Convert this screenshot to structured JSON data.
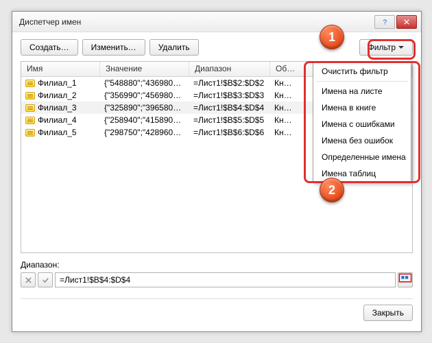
{
  "window": {
    "title": "Диспетчер имен"
  },
  "toolbar": {
    "create": "Создать…",
    "edit": "Изменить…",
    "delete": "Удалить",
    "filter": "Фильтр"
  },
  "columns": {
    "name": "Имя",
    "value": "Значение",
    "range": "Диапазон",
    "scope": "Об…"
  },
  "rows": [
    {
      "name": "Филиал_1",
      "value": "{\"548880\";\"436980…",
      "range": "=Лист1!$B$2:$D$2",
      "scope": "Кн…"
    },
    {
      "name": "Филиал_2",
      "value": "{\"356990\";\"456980…",
      "range": "=Лист1!$B$3:$D$3",
      "scope": "Кн…"
    },
    {
      "name": "Филиал_3",
      "value": "{\"325890\";\"396580…",
      "range": "=Лист1!$B$4:$D$4",
      "scope": "Кн…"
    },
    {
      "name": "Филиал_4",
      "value": "{\"258940\";\"415890…",
      "range": "=Лист1!$B$5:$D$5",
      "scope": "Кн…"
    },
    {
      "name": "Филиал_5",
      "value": "{\"298750\";\"428960…",
      "range": "=Лист1!$B$6:$D$6",
      "scope": "Кн…"
    }
  ],
  "footer": {
    "range_label": "Диапазон:",
    "range_value": "=Лист1!$B$4:$D$4",
    "close": "Закрыть"
  },
  "filter_menu": [
    "Очистить фильтр",
    "Имена на листе",
    "Имена в книге",
    "Имена с ошибками",
    "Имена без ошибок",
    "Определенные имена",
    "Имена таблиц"
  ],
  "badges": {
    "one": "1",
    "two": "2"
  }
}
